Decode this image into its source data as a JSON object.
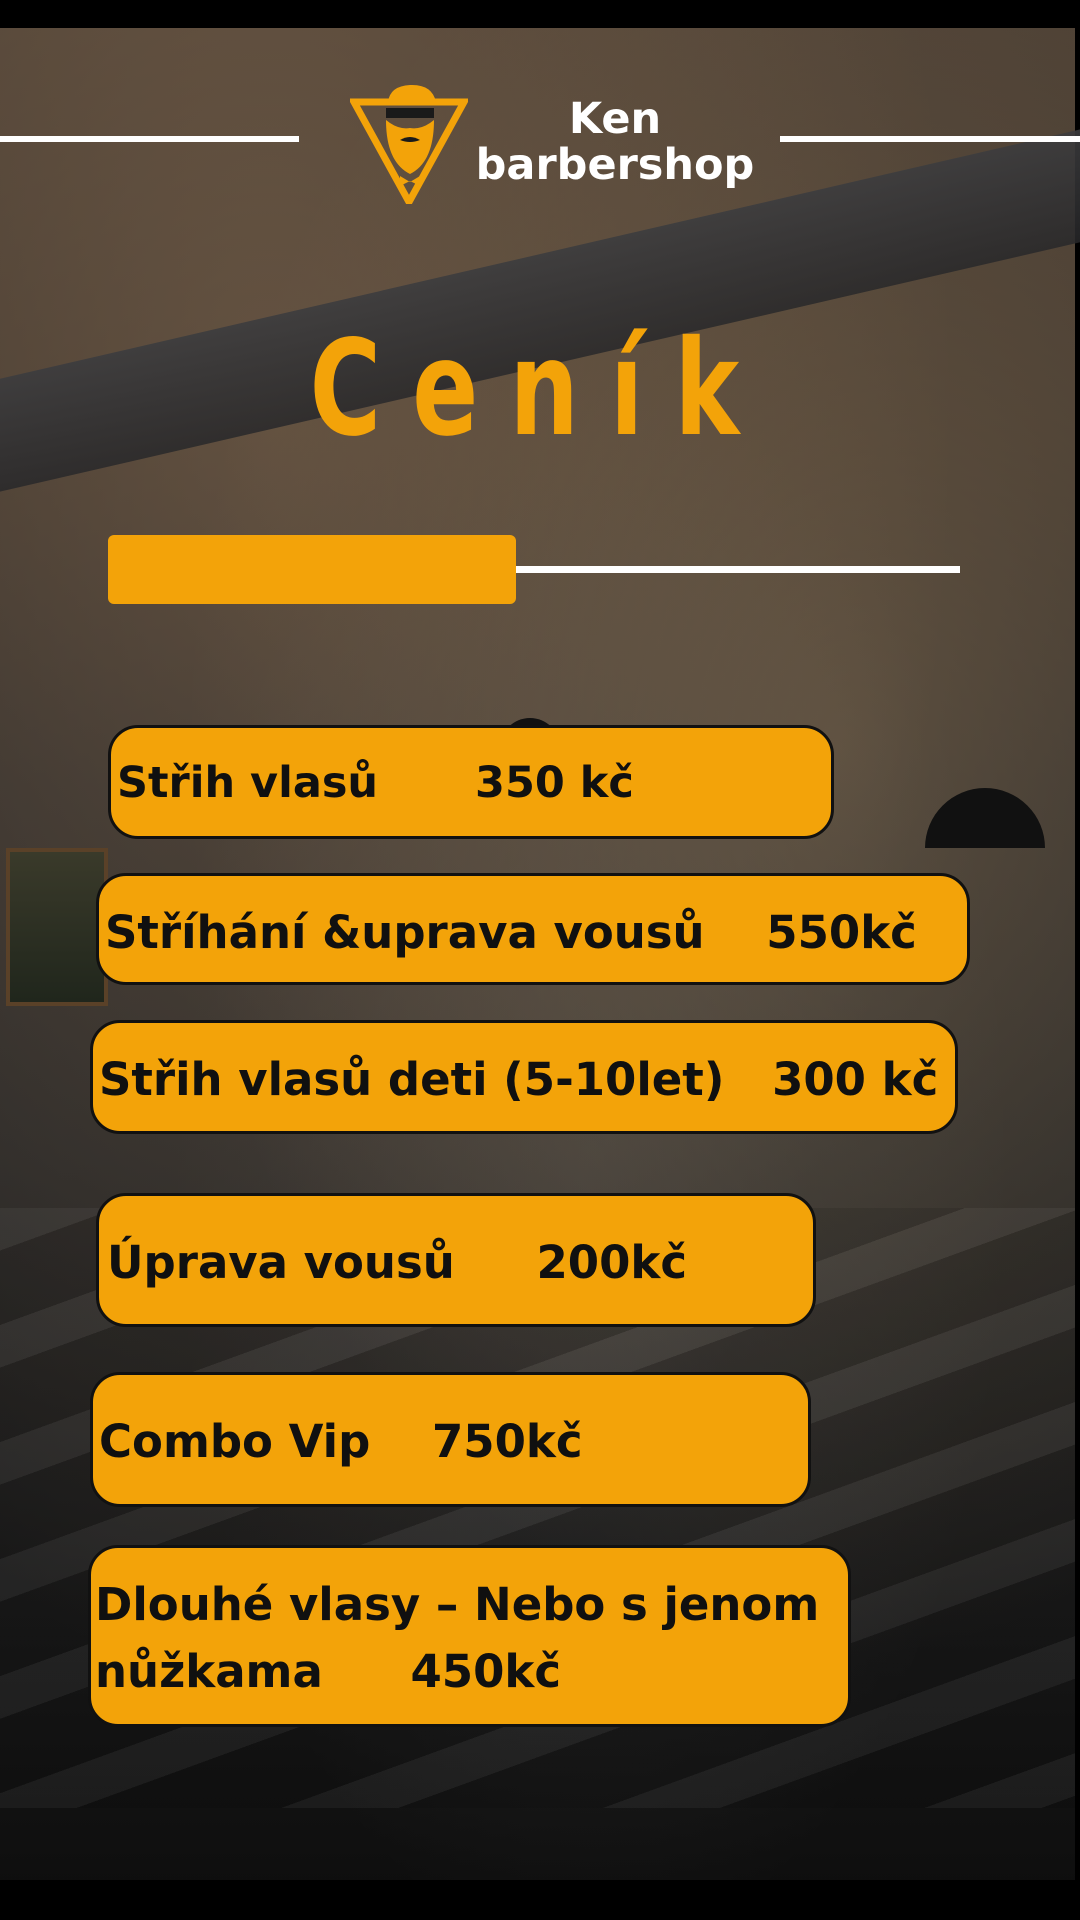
{
  "brand": {
    "line1": "Ken",
    "line2": "barbershop"
  },
  "title": "Ceník",
  "colors": {
    "accent": "#f3a309",
    "text_dark": "#101010",
    "white": "#ffffff"
  },
  "items": [
    {
      "name": "Střih vlasů",
      "price": "350 kč"
    },
    {
      "name": "Stříhání &uprava vousů",
      "price": "550kč"
    },
    {
      "name": "Střih vlasů deti (5-10let)",
      "price": "300 kč"
    },
    {
      "name": "Úprava vousů",
      "price": "200kč"
    },
    {
      "name": "Combo Vip",
      "price": "750kč"
    },
    {
      "name": "Dlouhé vlasy – Nebo s jenom",
      "name_line2": "nůžkama",
      "price": "450kč"
    }
  ],
  "icons": {
    "logo": "bearded-man-triangle-logo-icon"
  }
}
